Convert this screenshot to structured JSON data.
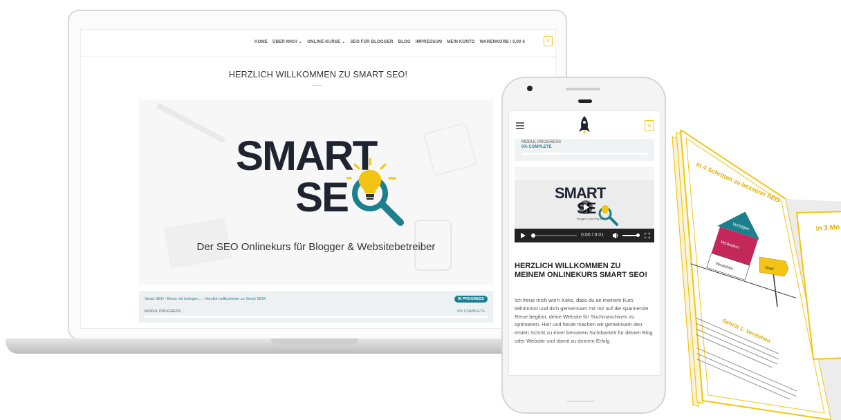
{
  "laptop": {
    "nav": {
      "items": [
        "HOME",
        "ÜBER MICH ⌄",
        "ONLINE-KURSE ⌄",
        "SEO FÜR BLOGGER",
        "BLOG",
        "IMPRESSUM",
        "MEIN KONTO",
        "WARENKORB / 0,00 €"
      ],
      "cart_count": "0"
    },
    "page_title": "HERZLICH WILLKOMMEN ZU SMART SEO!",
    "hero": {
      "logo_line1": "SMART",
      "logo_line2": "SE",
      "tagline": "Der SEO Onlinekurs für Blogger & Websitebetreiber"
    },
    "progress_card": {
      "breadcrumb": "Smart SEO › Bevor wir loslegen... › Herzlich willkommen zu Smart SEO!",
      "status_badge": "IN PROGRESS",
      "label": "MODUL PROGRESS",
      "percent_text": "0% COMPLETE",
      "progress": 0
    }
  },
  "phone": {
    "cart_count": "0",
    "progress": {
      "label": "MODUL PROGRESS",
      "percent_text": "0% COMPLETE"
    },
    "video": {
      "logo_line1": "SMART",
      "logo_line2": "SE",
      "subtitle": "Blogger-Coaching.de",
      "time": "0:00 / 8:01"
    },
    "title": "HERZLICH WILLKOMMEN ZU MEINEM ONLINEKURS SMART SEO!",
    "body": "Ich freue mich wie'n Keks, dass du an meinem Kurs teilnimmst und dich gemeinsam mit mir auf die spannende Reise begibst, deine Website für Suchmaschinen zu optimieren. Hier und heute machen wir gemeinsam den ersten Schritt zu einer besseren Sichtbarkeit für deinen Blog oder Website und damit zu deinem Erfolg."
  },
  "brochure": {
    "heading": "In 4 Schritten zu besserer SEO",
    "house_labels": [
      "Verfolgen",
      "Verändern",
      "Verstehen"
    ],
    "sign_label": "Start",
    "step_title": "Schritt 1: Verstehen",
    "second_heading": "In 3 Mo"
  },
  "colors": {
    "accent_teal": "#1d7f8c",
    "accent_yellow": "#f3c413",
    "logo_dark": "#1f2430"
  }
}
